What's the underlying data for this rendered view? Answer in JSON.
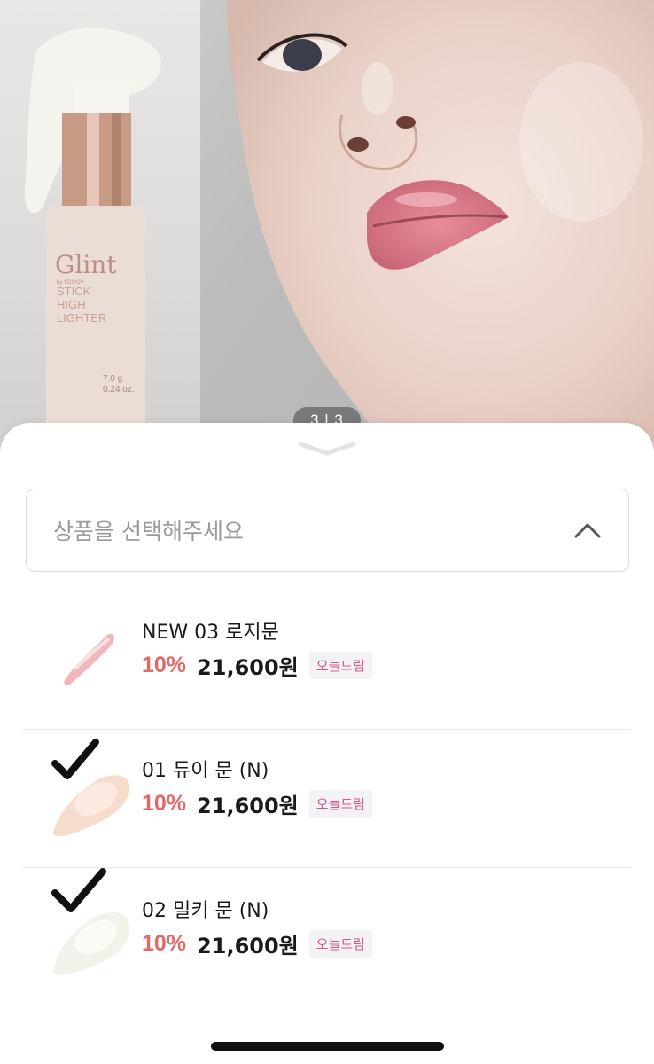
{
  "hero": {
    "product_brand": "Glint",
    "product_brand_sub": "by VDIVOV",
    "product_name_lines": [
      "STICK",
      "HIGH",
      "LIGHTER"
    ],
    "product_weight_g": "7.0 g",
    "product_weight_oz": "0.24 oz.",
    "page_indicator": "3 | 3"
  },
  "selector": {
    "placeholder": "상품을 선택해주세요"
  },
  "options": [
    {
      "name": "NEW 03 로지문",
      "discount": "10%",
      "price": "21,600원",
      "badge": "오늘드림",
      "checked": false
    },
    {
      "name": "01 듀이 문 (N)",
      "discount": "10%",
      "price": "21,600원",
      "badge": "오늘드림",
      "checked": true
    },
    {
      "name": "02 밀키 문 (N)",
      "discount": "10%",
      "price": "21,600원",
      "badge": "오늘드림",
      "checked": true
    }
  ],
  "colors": {
    "discount": "#e06a6a",
    "badge_text": "#d9548b",
    "badge_bg": "#f3f2f5"
  },
  "icons": [
    "chevron-up-icon",
    "sheet-handle-icon",
    "checkmark-icon"
  ]
}
